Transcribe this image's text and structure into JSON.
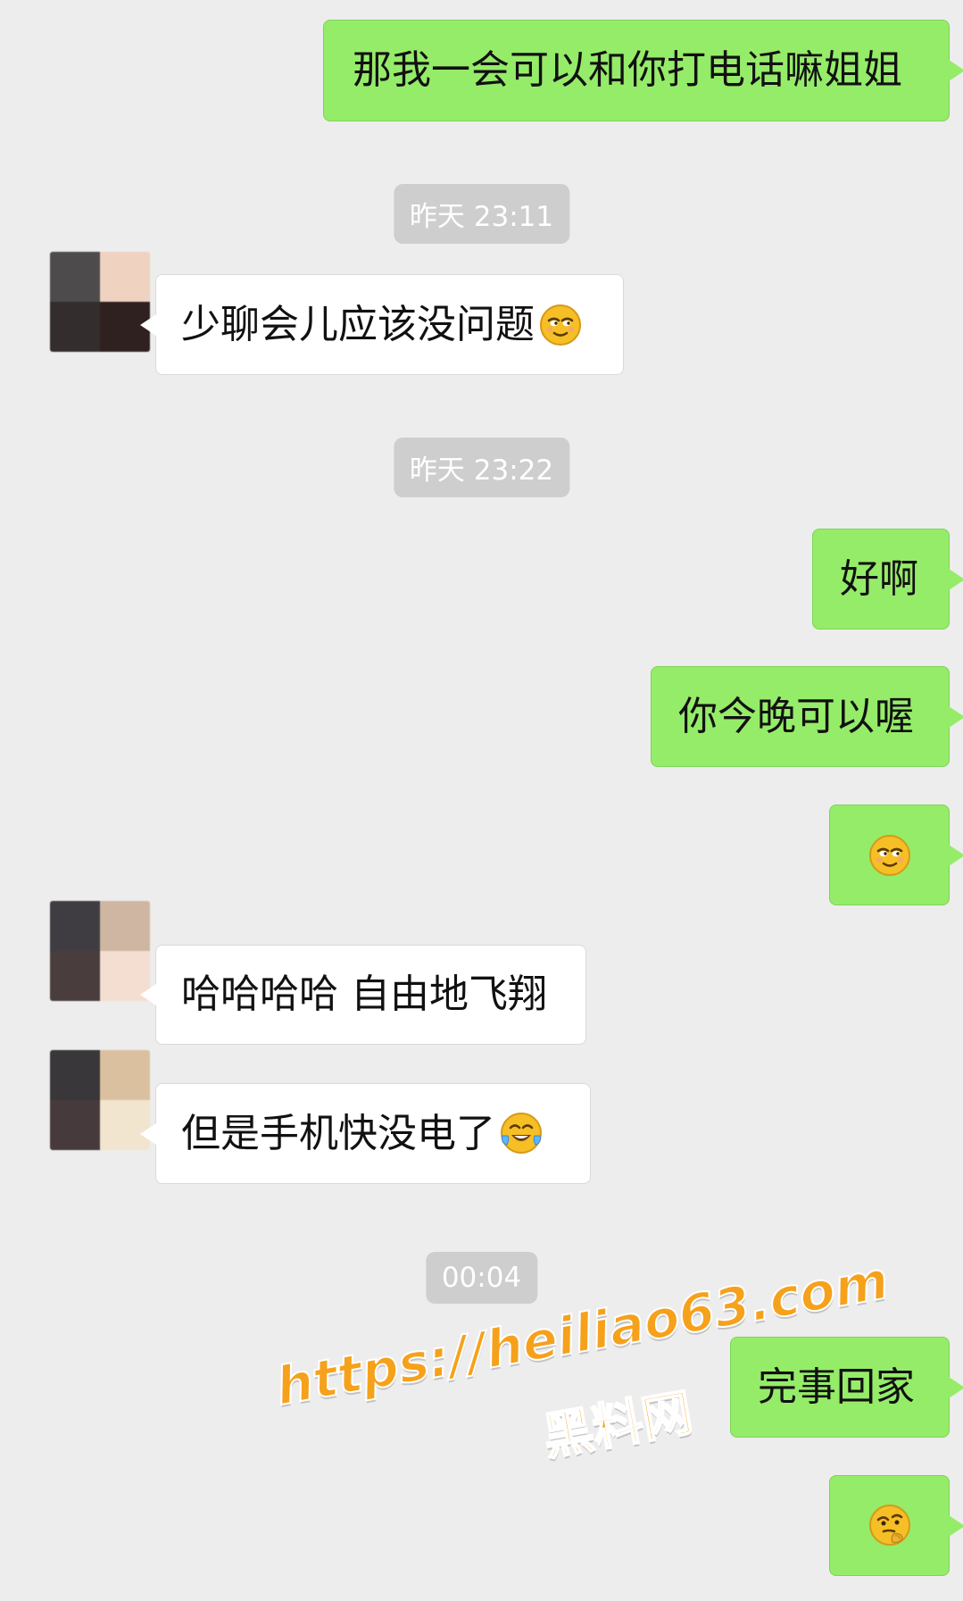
{
  "chat": {
    "messages": [
      {
        "text": "那我一会可以和你打电话嘛姐姐"
      },
      {
        "text": "少聊会儿应该没问题"
      },
      {
        "text": "好啊"
      },
      {
        "text": "你今晚可以喔"
      },
      {
        "text": "哈哈哈哈 自由地飞翔"
      },
      {
        "text": "但是手机快没电了"
      },
      {
        "text": "完事回家"
      }
    ],
    "timestamps": [
      "昨天 23:11",
      "昨天 23:22",
      "00:04"
    ]
  },
  "watermark": {
    "line1": "https://heiliao63.com",
    "line2": "黑料网"
  },
  "emoji_names": {
    "smirk": "smirking-face-emoji",
    "laugh": "tears-of-joy-emoji",
    "thinking": "thinking-face-emoji"
  }
}
